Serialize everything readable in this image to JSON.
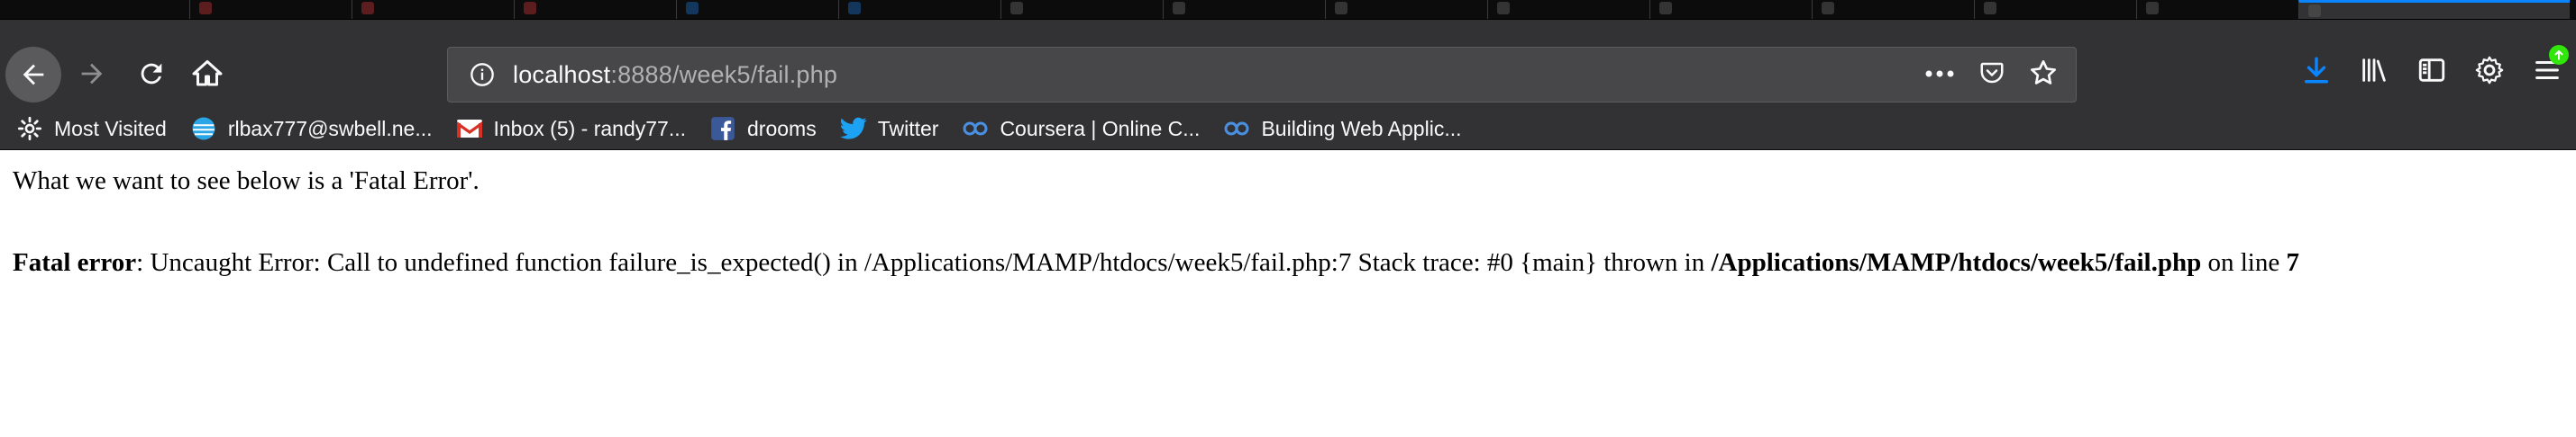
{
  "browser": {
    "url_host": "localhost",
    "url_rest": ":8888/week5/fail.php"
  },
  "bookmarks": [
    {
      "label": "Most Visited",
      "icon": "gear-icon"
    },
    {
      "label": "rlbax777@swbell.ne...",
      "icon": "att-icon"
    },
    {
      "label": "Inbox (5) - randy77...",
      "icon": "gmail-icon"
    },
    {
      "label": "drooms",
      "icon": "facebook-icon"
    },
    {
      "label": "Twitter",
      "icon": "twitter-icon"
    },
    {
      "label": "Coursera | Online C...",
      "icon": "coursera-icon"
    },
    {
      "label": "Building Web Applic...",
      "icon": "coursera-icon"
    }
  ],
  "page": {
    "intro": "What we want to see below is a 'Fatal Error'.",
    "error_label": "Fatal error",
    "error_message": ": Uncaught Error: Call to undefined function failure_is_expected() in /Applications/MAMP/htdocs/week5/fail.php:7 Stack trace: #0 {main} thrown in ",
    "error_file": "/Applications/MAMP/htdocs/week5/fail.php",
    "on_line_text": " on line ",
    "line_number": "7"
  },
  "colors": {
    "accent": "#0a84ff",
    "chrome_bg": "#323234",
    "url_bg": "#474749"
  }
}
